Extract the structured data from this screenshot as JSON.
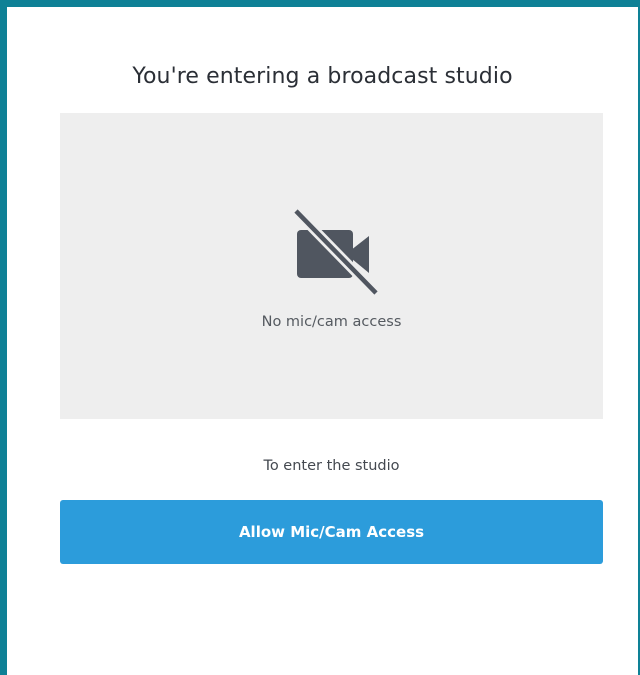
{
  "dialog": {
    "title": "You're entering a broadcast studio",
    "preview": {
      "icon": "camera-off-icon",
      "status_text": "No mic/cam access"
    },
    "hint": "To enter the studio",
    "allow_button_label": "Allow Mic/Cam Access"
  },
  "colors": {
    "frame_accent": "#0e8196",
    "button_background": "#2c9cdb",
    "preview_background": "#eeeeee",
    "icon_color": "#505660"
  }
}
